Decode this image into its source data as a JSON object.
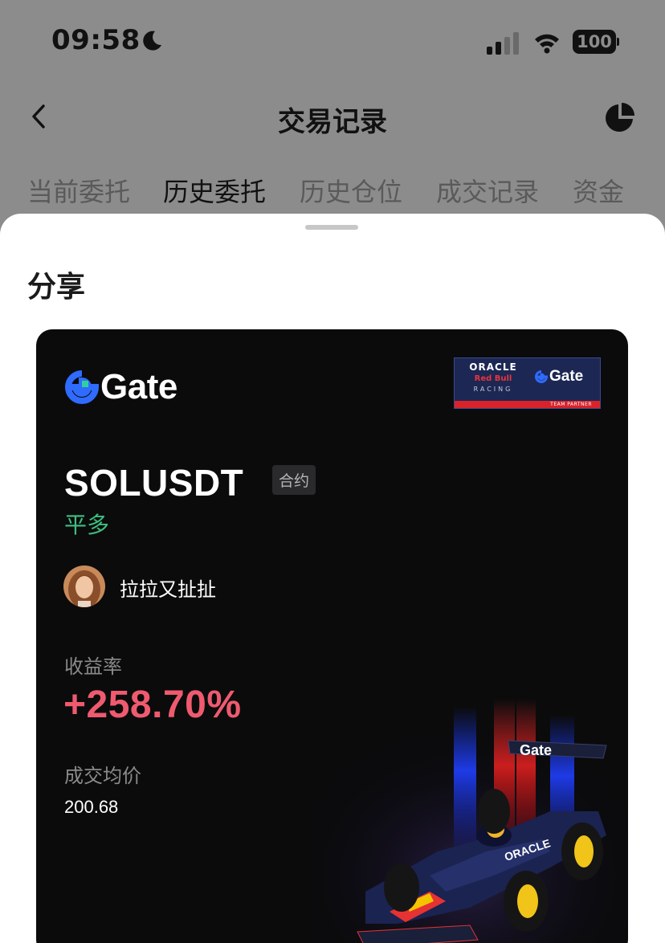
{
  "status_bar": {
    "time": "09:58",
    "battery": "100",
    "icons": [
      "moon-icon",
      "signal-icon",
      "wifi-icon",
      "battery-icon"
    ]
  },
  "nav": {
    "title": "交易记录",
    "icons": [
      "back-icon",
      "pie-chart-icon"
    ]
  },
  "tabs": [
    {
      "label": "当前委托",
      "active": false
    },
    {
      "label": "历史委托",
      "active": true
    },
    {
      "label": "历史仓位",
      "active": false
    },
    {
      "label": "成交记录",
      "active": false
    },
    {
      "label": "资金",
      "active": false
    }
  ],
  "sheet": {
    "title": "分享"
  },
  "card": {
    "brand": "Gate",
    "partner": {
      "oracle": "ORACLE",
      "redbull": "Red Bull",
      "racing": "RACING",
      "gate": "Gate",
      "team_partner": "TEAM PARTNER"
    },
    "pair": "SOLUSDT",
    "badge": "合约",
    "direction": "平多",
    "username": "拉拉又扯扯",
    "roi_label": "收益率",
    "roi_value": "+258.70%",
    "price_label": "成交均价",
    "price_value": "200.68",
    "car_livery_text": [
      "Gate",
      "ORACLE"
    ]
  },
  "colors": {
    "accent_green": "#3fbf7f",
    "accent_red": "#ef5a6f",
    "brand_blue": "#2f6bff",
    "card_bg": "#0b0b0c"
  }
}
